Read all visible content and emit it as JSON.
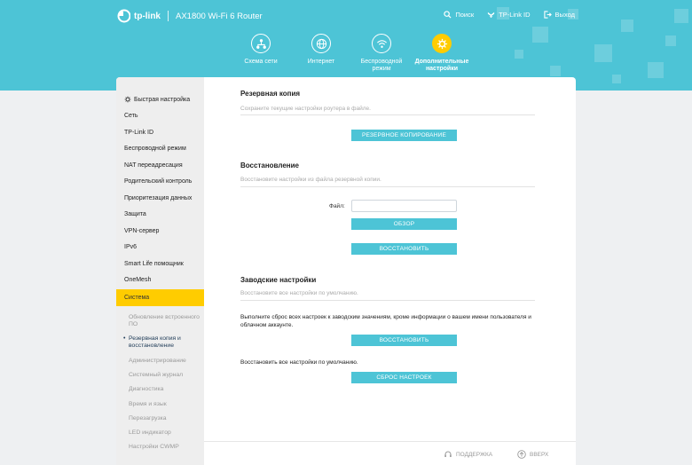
{
  "header": {
    "brand": "tp-link",
    "model": "AX1800 Wi-Fi 6 Router",
    "links": [
      {
        "label": "Поиск",
        "icon": "search-icon"
      },
      {
        "label": "TP-Link ID",
        "icon": "tplink-id-icon"
      },
      {
        "label": "Выход",
        "icon": "logout-icon"
      }
    ]
  },
  "nav": {
    "items": [
      {
        "label": "Схема сети",
        "icon": "network-map-icon"
      },
      {
        "label": "Интернет",
        "icon": "globe-icon"
      },
      {
        "label": "Беспроводной режим",
        "icon": "wifi-icon"
      },
      {
        "label": "Дополнительные настройки",
        "icon": "gear-icon"
      }
    ],
    "active_index": 3
  },
  "sidebar": {
    "items": [
      "Быстрая настройка",
      "Сеть",
      "TP-Link ID",
      "Беспроводной режим",
      "NAT переадресация",
      "Родительский контроль",
      "Приоритезация данных",
      "Защита",
      "VPN-сервер",
      "IPv6",
      "Smart Life помощник",
      "OneMesh",
      "Система"
    ],
    "sub_items": [
      "Обновление встроенного ПО",
      "Резервная копия и восстановление",
      "Администрирование",
      "Системный журнал",
      "Диагностика",
      "Время и язык",
      "Перезагрузка",
      "LED индикатор",
      "Настройки CWMP"
    ]
  },
  "backup": {
    "title": "Резервная копия",
    "desc": "Сохраните текущие настройки роутера в файле.",
    "button": "РЕЗЕРВНОЕ КОПИРОВАНИЕ"
  },
  "restore": {
    "title": "Восстановление",
    "desc": "Восстановите настройки из файла резервной копии.",
    "file_label": "Файл:",
    "file_value": "",
    "browse_button": "ОБЗОР",
    "restore_button": "ВОССТАНОВИТЬ"
  },
  "factory": {
    "title": "Заводские настройки",
    "desc": "Восстановите все настройки по умолчанию.",
    "text1": "Выполните сброс всех настроек к заводским значениям, кроме информации о вашем имени пользователя и облачном аккаунте.",
    "restore_button": "ВОССТАНОВИТЬ",
    "text2": "Восстановить все настройки по умолчанию.",
    "reset_button": "СБРОС НАСТРОЕК"
  },
  "footer": {
    "support": "ПОДДЕРЖКА",
    "top": "ВВЕРХ"
  },
  "colors": {
    "accent": "#4dc4d6",
    "active": "#ffcc00"
  }
}
